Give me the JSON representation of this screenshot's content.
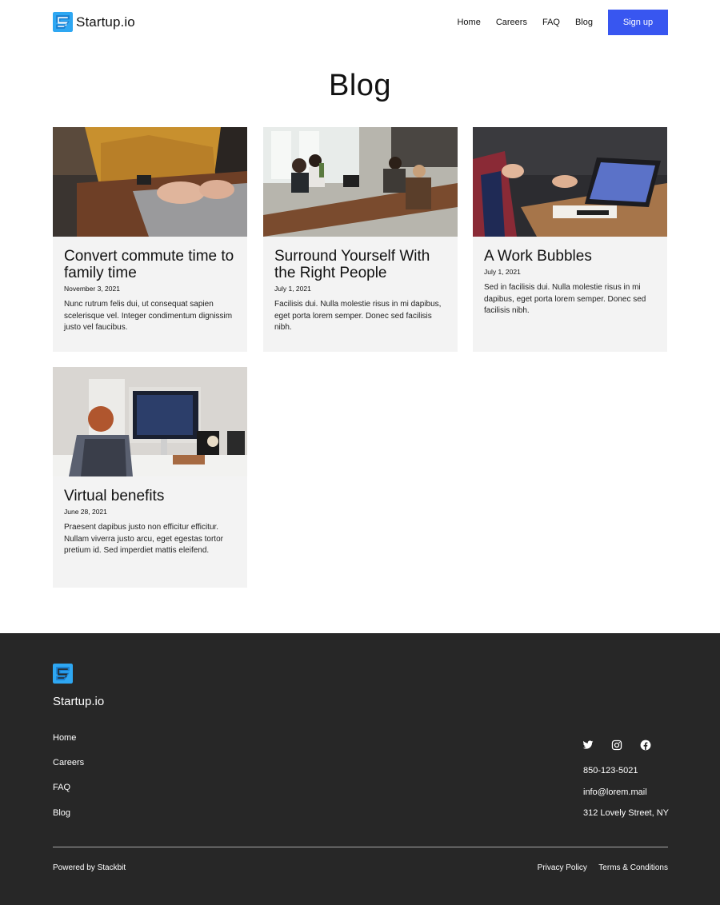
{
  "header": {
    "brand": "Startup.io",
    "nav": [
      "Home",
      "Careers",
      "FAQ",
      "Blog"
    ],
    "signup_label": "Sign up"
  },
  "page": {
    "title": "Blog"
  },
  "posts": [
    {
      "title": "Convert commute time to family time",
      "date": "November 3, 2021",
      "excerpt": "Nunc rutrum felis dui, ut consequat sapien scelerisque vel. Integer condimentum dignissim justo vel faucibus."
    },
    {
      "title": "Surround Yourself With the Right People",
      "date": "July 1, 2021",
      "excerpt": "Facilisis dui. Nulla molestie risus in mi dapibus, eget porta lorem semper. Donec sed facilisis nibh."
    },
    {
      "title": "A Work Bubbles",
      "date": "July 1, 2021",
      "excerpt": "Sed in facilisis dui. Nulla molestie risus in mi dapibus, eget porta lorem semper. Donec sed facilisis nibh."
    },
    {
      "title": "Virtual benefits",
      "date": "June 28, 2021",
      "excerpt": "Praesent dapibus justo non efficitur efficitur. Nullam viverra justo arcu, eget egestas tortor pretium id. Sed imperdiet mattis eleifend."
    }
  ],
  "footer": {
    "brand": "Startup.io",
    "links": [
      "Home",
      "Careers",
      "FAQ",
      "Blog"
    ],
    "social_icons": [
      "twitter-icon",
      "instagram-icon",
      "facebook-icon"
    ],
    "phone": "850-123-5021",
    "email": "info@lorem.mail",
    "address": "312 Lovely Street, NY",
    "powered_by": "Powered by Stackbit",
    "legal": [
      "Privacy Policy",
      "Terms & Conditions"
    ]
  },
  "colors": {
    "accent": "#3856f0",
    "logo": "#2ea7f2",
    "footer_bg": "#272727",
    "card_bg": "#f3f3f3"
  }
}
